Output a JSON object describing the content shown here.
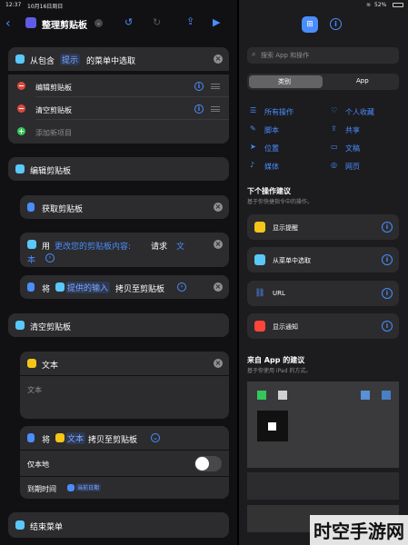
{
  "status": {
    "time": "12:37",
    "date": "10月16日周日",
    "battery": "52%"
  },
  "toolbar": {
    "title": "整理剪贴板"
  },
  "menu_block": {
    "prefix": "从包含",
    "prompt_chip": "提示",
    "suffix": "的菜单中选取",
    "items": [
      {
        "label": "编辑剪贴板"
      },
      {
        "label": "清空剪贴板"
      }
    ],
    "add_item": "添加新项目"
  },
  "section_edit": {
    "label": "编辑剪贴板"
  },
  "get_clipboard": {
    "label": "获取剪贴板"
  },
  "ask_block": {
    "prefix": "用",
    "prompt": "更改您的剪贴板内容:",
    "request": "请求",
    "type_line1": "文",
    "type_line2": "本"
  },
  "copy_block_1": {
    "prefix": "将",
    "chip": "提供的输入",
    "suffix": "拷贝至剪贴板"
  },
  "section_clear": {
    "label": "清空剪贴板"
  },
  "text_block": {
    "title": "文本",
    "placeholder": "文本"
  },
  "copy_block_2": {
    "prefix": "将",
    "chip": "文本",
    "suffix": "拷贝至剪贴板",
    "local_only": "仅本地",
    "expires_label": "到期时间",
    "expires_value": "当前日期"
  },
  "end_menu": {
    "label": "结束菜单"
  },
  "right": {
    "search_placeholder": "搜索 App 和操作",
    "seg_categories": "类别",
    "seg_apps": "App",
    "categories": [
      {
        "label": "所有操作",
        "icon": "list-icon"
      },
      {
        "label": "个人收藏",
        "icon": "heart-icon"
      },
      {
        "label": "脚本",
        "icon": "script-icon"
      },
      {
        "label": "共享",
        "icon": "share-icon"
      },
      {
        "label": "位置",
        "icon": "location-icon"
      },
      {
        "label": "文稿",
        "icon": "document-icon"
      },
      {
        "label": "媒体",
        "icon": "music-icon"
      },
      {
        "label": "网页",
        "icon": "compass-icon"
      }
    ],
    "next_title": "下个操作建议",
    "next_sub": "基于你快捷指令中的操作。",
    "suggestions": [
      {
        "label": "显示提醒",
        "color": "#f5c518"
      },
      {
        "label": "从菜单中选取",
        "color": "#5ac8fa"
      },
      {
        "label": "URL",
        "color": "#2c2c2e"
      },
      {
        "label": "显示通知",
        "color": "#ff453a"
      }
    ],
    "apps_title": "来自 App 的建议",
    "apps_sub": "基于你使用 iPad 的方式。"
  },
  "watermark": {
    "text": "时空手游网"
  },
  "colors": {
    "accent": "#4a8dff",
    "card": "#2c2c2e",
    "background": "#111113"
  }
}
